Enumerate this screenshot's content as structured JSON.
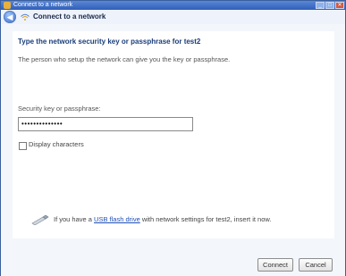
{
  "window": {
    "title": "Connect to a network"
  },
  "nav": {
    "title": "Connect to a network"
  },
  "content": {
    "heading": "Type the network security key or passphrase for test2",
    "description": "The person who setup the network can give you the key or passphrase.",
    "key_label": "Security key or passphrase:",
    "key_value": "••••••••••••••",
    "display_chars_label": "Display characters",
    "usb": {
      "prefix": "If you have a",
      "link": "USB flash drive",
      "suffix": "with network settings for test2, insert it now."
    }
  },
  "buttons": {
    "connect": "Connect",
    "cancel": "Cancel"
  },
  "titlebar": {
    "min": "_",
    "max": "□",
    "close": "✕"
  }
}
